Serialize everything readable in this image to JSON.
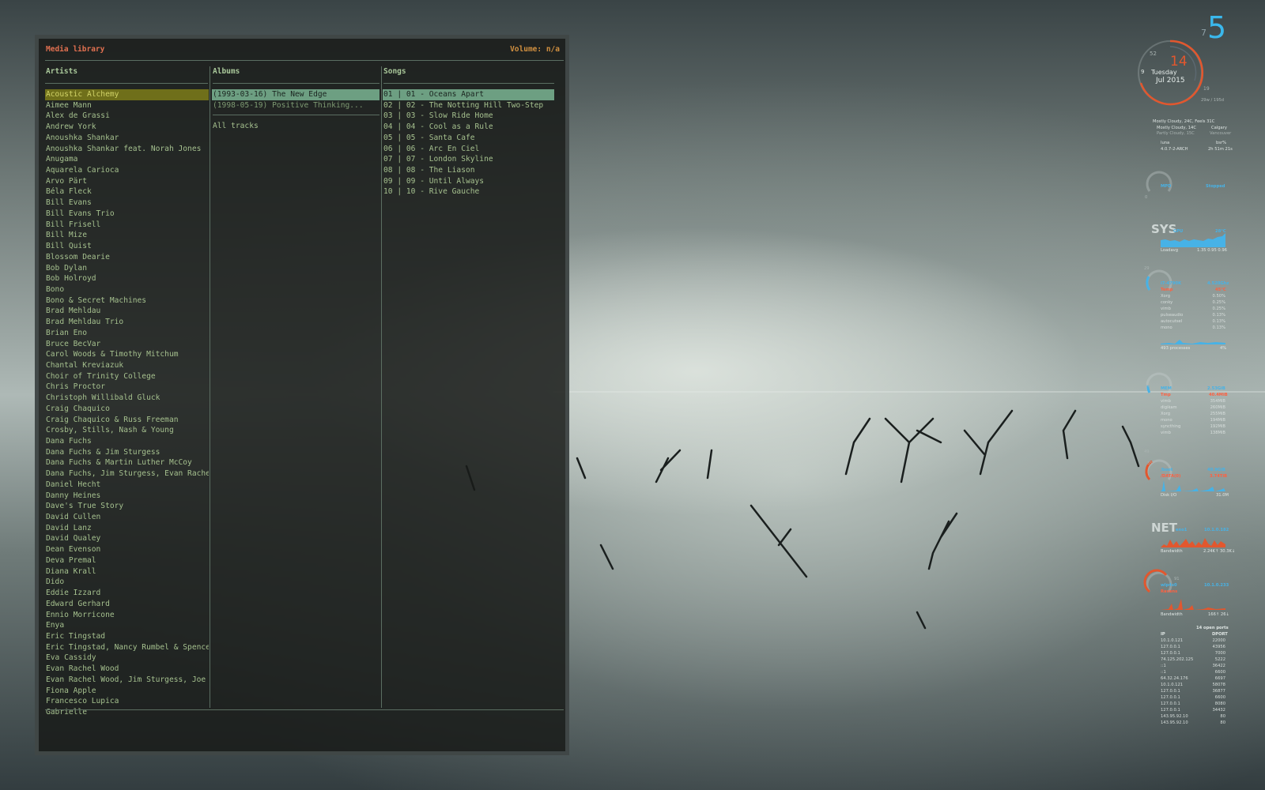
{
  "terminal": {
    "title": "Media library",
    "volume": "Volume: n/a",
    "columns": {
      "artists": "Artists",
      "albums": "Albums",
      "songs": "Songs"
    },
    "artists": [
      "Acoustic Alchemy",
      "Aimee Mann",
      "Alex de Grassi",
      "Andrew York",
      "Anoushka Shankar",
      "Anoushka Shankar feat. Norah Jones",
      "Anugama",
      "Aquarela Carioca",
      "Arvo Pärt",
      "Béla Fleck",
      "Bill Evans",
      "Bill Evans Trio",
      "Bill Frisell",
      "Bill Mize",
      "Bill Quist",
      "Blossom Dearie",
      "Bob Dylan",
      "Bob Holroyd",
      "Bono",
      "Bono & Secret Machines",
      "Brad Mehldau",
      "Brad Mehldau Trio",
      "Brian Eno",
      "Bruce BecVar",
      "Carol Woods & Timothy Mitchum",
      "Chantal Kreviazuk",
      "Choir of Trinity College",
      "Chris Proctor",
      "Christoph Willibald Gluck",
      "Craig Chaquico",
      "Craig Chaquico & Russ Freeman",
      "Crosby, Stills, Nash & Young",
      "Dana Fuchs",
      "Dana Fuchs & Jim Sturgess",
      "Dana Fuchs & Martin Luther McCoy",
      "Dana Fuchs, Jim Sturgess, Evan Rachel Wood",
      "Daniel Hecht",
      "Danny Heines",
      "Dave's True Story",
      "David Cullen",
      "David Lanz",
      "David Qualey",
      "Dean Evenson",
      "Deva Premal",
      "Diana Krall",
      "Dido",
      "Eddie Izzard",
      "Edward Gerhard",
      "Ennio Morricone",
      "Enya",
      "Eric Tingstad",
      "Eric Tingstad, Nancy Rumbel & Spencer Brew",
      "Eva Cassidy",
      "Evan Rachel Wood",
      "Evan Rachel Wood, Jim Sturgess, Joe Anders",
      "Fiona Apple",
      "Francesco Lupica",
      "Gabrielle"
    ],
    "albums": [
      "(1993-03-16) The New Edge",
      "(1998-05-19) Positive Thinking..."
    ],
    "all_tracks": "All tracks",
    "songs": [
      "01 | 01 - Oceans Apart",
      "02 | 02 - The Notting Hill Two-Step",
      "03 | 03 - Slow Ride Home",
      "04 | 04 - Cool as a Rule",
      "05 | 05 - Santa Cafe",
      "06 | 06 - Arc En Ciel",
      "07 | 07 - London Skyline",
      "08 | 08 - The Liason",
      "09 | 09 - Until Always",
      "10 | 10 - Rive Gauche"
    ]
  },
  "conky": {
    "workspace_small": "7",
    "workspace_big": "5",
    "clock": {
      "min": "52",
      "hour": "9",
      "day": "14",
      "weekday": "Tuesday",
      "monthyear": "Jul 2015",
      "sec": "19",
      "week": "29w / 195d"
    },
    "weather": {
      "main": "Mostly Cloudy, 24C, Feels 31C",
      "w2": "Mostly Cloudy, 14C",
      "c2": "Calgary",
      "w3": "Partly Cloudy, 15C",
      "c3": "Vancouver"
    },
    "host": {
      "name": "luna",
      "user": "bsr%",
      "kernel": "4.0.7-2-ARCH",
      "uptime": "2h 51m 21s"
    },
    "mpd": {
      "label": "MPD",
      "status": "Stopped",
      "val": "0"
    },
    "sys": {
      "title": "SYS",
      "gpu": "GPU",
      "gpu_temp": "28°C",
      "loadavg": "Loadavg",
      "load": "1.35  0.95  0.96"
    },
    "cpu": {
      "pct": "29",
      "name": "i7-4790K",
      "freq": "4.520Ghz",
      "temp_lbl": "Temp",
      "temp": "45°C",
      "procs": [
        [
          "Xorg",
          "0.50%"
        ],
        [
          "conky",
          "0.25%"
        ],
        [
          "vimb",
          "0.25%"
        ],
        [
          "pulseaudio",
          "0.13%"
        ],
        [
          "autocutsel",
          "0.13%"
        ],
        [
          "mono",
          "0.13%"
        ]
      ],
      "processes": "493 processes",
      "total": "4%"
    },
    "mem": {
      "pct": "16",
      "name": "MEM",
      "size": "2.53GiB",
      "tmp_lbl": "Tmp",
      "tmp": "40.4MiB",
      "procs": [
        [
          "vimb",
          "354MiB"
        ],
        [
          "digikam",
          "260MiB"
        ],
        [
          "Xorg",
          "255MiB"
        ],
        [
          "mono",
          "194MiB"
        ],
        [
          "syncthing",
          "192MiB"
        ],
        [
          "vimb",
          "138MiB"
        ]
      ]
    },
    "disk": {
      "pct": "35",
      "small": "49",
      "root": "/boot",
      "root_val": "40.9GiB",
      "data": "/DATA(0)",
      "data_val": "3.74TiB",
      "io": "Disk I/O",
      "io_val": "31.0M"
    },
    "net": {
      "title": "NET",
      "eno": "eno1",
      "eno_ip": "10.1.0.182",
      "bw": "Bandwidth",
      "bw_val": "2.24K↑ 30.3K↓",
      "wl": "wlp4s0",
      "wl_ip": "10.1.0.233",
      "essid": "Ravens",
      "wl_pct": "91",
      "bw2_val": "166↑ 26↓"
    },
    "ports": {
      "title": "14 open ports",
      "ip_h": "IP",
      "port_h": "DPORT",
      "rows": [
        [
          "10.1.0.121",
          "22000"
        ],
        [
          "127.0.0.1",
          "43956"
        ],
        [
          "127.0.0.1",
          "7000"
        ],
        [
          "74.125.202.125",
          "5222"
        ],
        [
          "::1",
          "36422"
        ],
        [
          "::1",
          "6600"
        ],
        [
          "64.32.24.176",
          "6697"
        ],
        [
          "10.1.0.121",
          "58078"
        ],
        [
          "127.0.0.1",
          "36877"
        ],
        [
          "127.0.0.1",
          "6600"
        ],
        [
          "127.0.0.1",
          "8080"
        ],
        [
          "127.0.0.1",
          "34432"
        ],
        [
          "143.95.92.10",
          "80"
        ],
        [
          "143.95.92.10",
          "80"
        ]
      ]
    },
    "colors": {
      "blue": "#47b2e6",
      "red": "#ff6040"
    }
  }
}
